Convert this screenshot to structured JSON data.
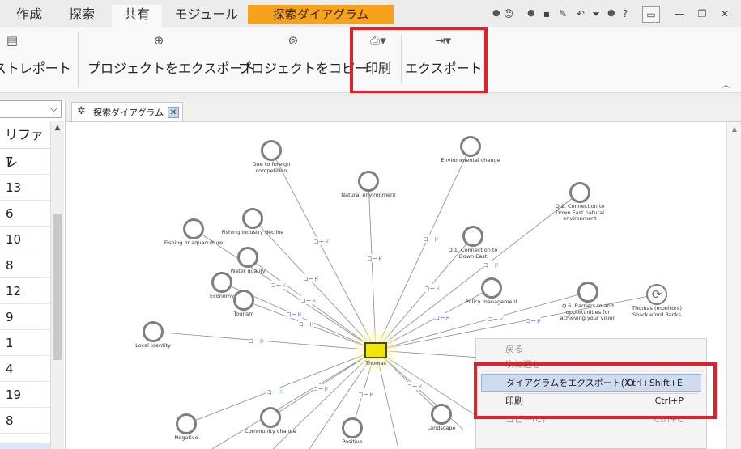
{
  "menubar": {
    "tabs": [
      "作成",
      "探索",
      "共有",
      "モジュール",
      "探索ダイアグラム"
    ],
    "active_tab": "共有",
    "accent_tab_color": "#f7a21a",
    "quick_access_icons": [
      "account-icon",
      "save-icon",
      "edit-icon",
      "undo-icon",
      "dropdown-icon",
      "help-icon"
    ],
    "window_icons": [
      "comment-icon",
      "minimize-icon",
      "restore-icon",
      "close-icon"
    ]
  },
  "ribbon": {
    "buttons": [
      {
        "label": "キストレポート",
        "icon": "text-report-icon"
      },
      {
        "label": "プロジェクトをエクスポート",
        "icon": "export-project-icon"
      },
      {
        "label": "プロジェクトをコピー",
        "icon": "copy-project-icon"
      },
      {
        "label": "印刷",
        "icon": "printer-icon"
      },
      {
        "label": "エクスポート",
        "icon": "export-icon"
      }
    ],
    "highlight_color": "#e0202a"
  },
  "left_panel": {
    "column_header": "リファレ",
    "rows": [
      "7",
      "13",
      "6",
      "10",
      "8",
      "12",
      "9",
      "1",
      "4",
      "19",
      "8"
    ]
  },
  "document_tab": {
    "title": "探索ダイアグラム",
    "icon": "diagram-icon",
    "close": "✕"
  },
  "diagram": {
    "center_label": "Thomas",
    "edge_label": "コード",
    "nodes": [
      {
        "id": "n1",
        "label": "Due to foreign competition"
      },
      {
        "id": "n2",
        "label": "Natural environment"
      },
      {
        "id": "n3",
        "label": "Environmental change"
      },
      {
        "id": "n4",
        "label": "Q.2. Connection to Down East natural environment"
      },
      {
        "id": "n5",
        "label": "Fishing industry decline"
      },
      {
        "id": "n6",
        "label": "Fishing or aquaculture"
      },
      {
        "id": "n7",
        "label": "Q.1. Connection to Down East"
      },
      {
        "id": "n8",
        "label": "Water quality"
      },
      {
        "id": "n9",
        "label": "Economy"
      },
      {
        "id": "n10",
        "label": "Tourism"
      },
      {
        "id": "n11",
        "label": "Policy management"
      },
      {
        "id": "n12",
        "label": "Q.6. Barriers to and opportunities for achieving your vision"
      },
      {
        "id": "n13",
        "label": "Thomas (monitors) Shackleford Banks"
      },
      {
        "id": "n14",
        "label": "Local identity"
      },
      {
        "id": "n15",
        "label": "Negative"
      },
      {
        "id": "n16",
        "label": "Community change"
      },
      {
        "id": "n17",
        "label": "Positive"
      },
      {
        "id": "n18",
        "label": "Landscape"
      }
    ]
  },
  "context_menu": {
    "items": [
      {
        "label": "戻る",
        "shortcut": "",
        "state": "disabled"
      },
      {
        "label": "次に進む",
        "shortcut": "",
        "state": "disabled"
      },
      {
        "label": "ダイアグラムをエクスポート(X)",
        "shortcut": "Ctrl+Shift+E",
        "state": "highlighted"
      },
      {
        "label": "印刷",
        "shortcut": "Ctrl+P",
        "state": "enabled"
      },
      {
        "label": "コピー(C)",
        "shortcut": "Ctrl+C",
        "state": "disabled"
      }
    ]
  }
}
